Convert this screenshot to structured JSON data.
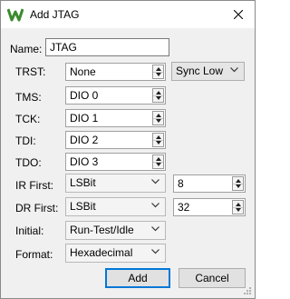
{
  "window": {
    "title": "Add JTAG",
    "colors": {
      "accent": "#0078d7",
      "logo_green": "#3a8a2e"
    }
  },
  "form": {
    "name": {
      "label": "Name:",
      "value": "JTAG"
    },
    "trst": {
      "label": "TRST:",
      "value": "None",
      "mode": "Sync Low"
    },
    "tms": {
      "label": "TMS:",
      "value": "DIO 0"
    },
    "tck": {
      "label": "TCK:",
      "value": "DIO 1"
    },
    "tdi": {
      "label": "TDI:",
      "value": "DIO 2"
    },
    "tdo": {
      "label": "TDO:",
      "value": "DIO 3"
    },
    "ir_first": {
      "label": "IR First:",
      "value": "LSBit",
      "length": "8"
    },
    "dr_first": {
      "label": "DR First:",
      "value": "LSBit",
      "length": "32"
    },
    "initial": {
      "label": "Initial:",
      "value": "Run-Test/Idle"
    },
    "format": {
      "label": "Format:",
      "value": "Hexadecimal"
    }
  },
  "buttons": {
    "add": "Add",
    "cancel": "Cancel"
  },
  "icons": {
    "app": "waveforms-logo-icon",
    "close": "close-icon",
    "resize": "resize-grip-icon"
  }
}
